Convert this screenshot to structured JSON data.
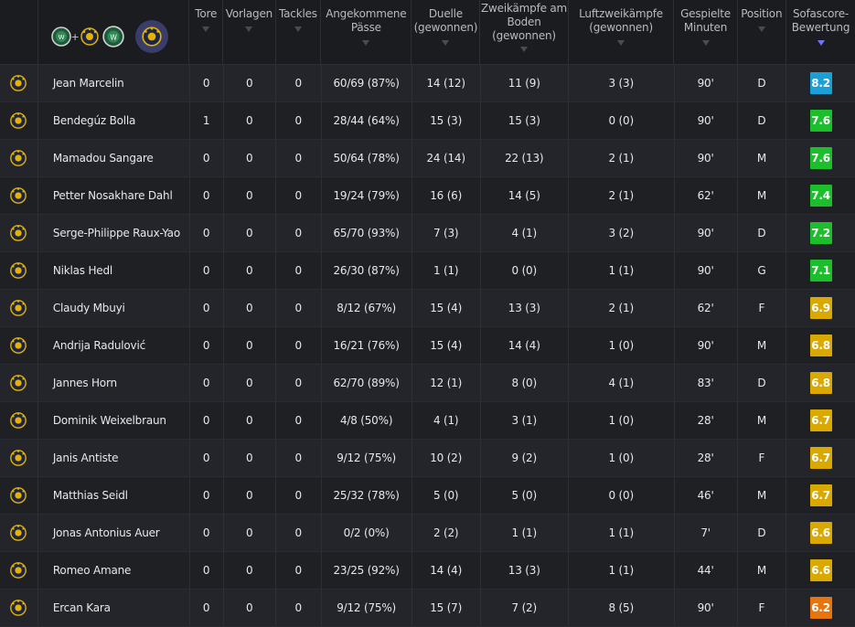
{
  "columns": [
    {
      "label": "Tore"
    },
    {
      "label": "Vorlagen"
    },
    {
      "label": "Tackles"
    },
    {
      "label": "Angekommene Pässe"
    },
    {
      "label": "Duelle (gewonnen)"
    },
    {
      "label": "Zweikämpfe am Boden (gewonnen)"
    },
    {
      "label": "Luftzweikämpfe (gewonnen)"
    },
    {
      "label": "Gespielte Minuten"
    },
    {
      "label": "Position"
    },
    {
      "label": "Sofascore-Bewertung"
    }
  ],
  "team_filter": {
    "plus": "+",
    "icons": [
      "team-a-crest-icon",
      "team-b-crest-icon",
      "team-a-crest-icon",
      "team-b-crest-icon"
    ]
  },
  "colors": {
    "rating_blue": "#1a9fd6",
    "rating_green": "#1cbf2b",
    "rating_yellow": "#d9a900",
    "rating_orange": "#e8740c",
    "sort_active": "#6f73ff"
  },
  "players": [
    {
      "name": "Jean Marcelin",
      "goals": "0",
      "assists": "0",
      "tackles": "0",
      "passes": "60/69 (87%)",
      "duels": "14 (12)",
      "ground": "11 (9)",
      "aerial": "3 (3)",
      "minutes": "90'",
      "position": "D",
      "rating": "8.2",
      "rating_color": "blue"
    },
    {
      "name": "Bendegúz Bolla",
      "goals": "1",
      "assists": "0",
      "tackles": "0",
      "passes": "28/44 (64%)",
      "duels": "15 (3)",
      "ground": "15 (3)",
      "aerial": "0 (0)",
      "minutes": "90'",
      "position": "D",
      "rating": "7.6",
      "rating_color": "green"
    },
    {
      "name": "Mamadou Sangare",
      "goals": "0",
      "assists": "0",
      "tackles": "0",
      "passes": "50/64 (78%)",
      "duels": "24 (14)",
      "ground": "22 (13)",
      "aerial": "2 (1)",
      "minutes": "90'",
      "position": "M",
      "rating": "7.6",
      "rating_color": "green"
    },
    {
      "name": "Petter Nosakhare Dahl",
      "goals": "0",
      "assists": "0",
      "tackles": "0",
      "passes": "19/24 (79%)",
      "duels": "16 (6)",
      "ground": "14 (5)",
      "aerial": "2 (1)",
      "minutes": "62'",
      "position": "M",
      "rating": "7.4",
      "rating_color": "green"
    },
    {
      "name": "Serge-Philippe Raux-Yao",
      "goals": "0",
      "assists": "0",
      "tackles": "0",
      "passes": "65/70 (93%)",
      "duels": "7 (3)",
      "ground": "4 (1)",
      "aerial": "3 (2)",
      "minutes": "90'",
      "position": "D",
      "rating": "7.2",
      "rating_color": "green"
    },
    {
      "name": "Niklas Hedl",
      "goals": "0",
      "assists": "0",
      "tackles": "0",
      "passes": "26/30 (87%)",
      "duels": "1 (1)",
      "ground": "0 (0)",
      "aerial": "1 (1)",
      "minutes": "90'",
      "position": "G",
      "rating": "7.1",
      "rating_color": "green"
    },
    {
      "name": "Claudy Mbuyi",
      "goals": "0",
      "assists": "0",
      "tackles": "0",
      "passes": "8/12 (67%)",
      "duels": "15 (4)",
      "ground": "13 (3)",
      "aerial": "2 (1)",
      "minutes": "62'",
      "position": "F",
      "rating": "6.9",
      "rating_color": "yellow"
    },
    {
      "name": "Andrija Radulović",
      "goals": "0",
      "assists": "0",
      "tackles": "0",
      "passes": "16/21 (76%)",
      "duels": "15 (4)",
      "ground": "14 (4)",
      "aerial": "1 (0)",
      "minutes": "90'",
      "position": "M",
      "rating": "6.8",
      "rating_color": "yellow"
    },
    {
      "name": "Jannes Horn",
      "goals": "0",
      "assists": "0",
      "tackles": "0",
      "passes": "62/70 (89%)",
      "duels": "12 (1)",
      "ground": "8 (0)",
      "aerial": "4 (1)",
      "minutes": "83'",
      "position": "D",
      "rating": "6.8",
      "rating_color": "yellow"
    },
    {
      "name": "Dominik Weixelbraun",
      "goals": "0",
      "assists": "0",
      "tackles": "0",
      "passes": "4/8 (50%)",
      "duels": "4 (1)",
      "ground": "3 (1)",
      "aerial": "1 (0)",
      "minutes": "28'",
      "position": "M",
      "rating": "6.7",
      "rating_color": "yellow"
    },
    {
      "name": "Janis Antiste",
      "goals": "0",
      "assists": "0",
      "tackles": "0",
      "passes": "9/12 (75%)",
      "duels": "10 (2)",
      "ground": "9 (2)",
      "aerial": "1 (0)",
      "minutes": "28'",
      "position": "F",
      "rating": "6.7",
      "rating_color": "yellow"
    },
    {
      "name": "Matthias Seidl",
      "goals": "0",
      "assists": "0",
      "tackles": "0",
      "passes": "25/32 (78%)",
      "duels": "5 (0)",
      "ground": "5 (0)",
      "aerial": "0 (0)",
      "minutes": "46'",
      "position": "M",
      "rating": "6.7",
      "rating_color": "yellow"
    },
    {
      "name": "Jonas Antonius Auer",
      "goals": "0",
      "assists": "0",
      "tackles": "0",
      "passes": "0/2 (0%)",
      "duels": "2 (2)",
      "ground": "1 (1)",
      "aerial": "1 (1)",
      "minutes": "7'",
      "position": "D",
      "rating": "6.6",
      "rating_color": "yellow"
    },
    {
      "name": "Romeo Amane",
      "goals": "0",
      "assists": "0",
      "tackles": "0",
      "passes": "23/25 (92%)",
      "duels": "14 (4)",
      "ground": "13 (3)",
      "aerial": "1 (1)",
      "minutes": "44'",
      "position": "M",
      "rating": "6.6",
      "rating_color": "yellow"
    },
    {
      "name": "Ercan Kara",
      "goals": "0",
      "assists": "0",
      "tackles": "0",
      "passes": "9/12 (75%)",
      "duels": "15 (7)",
      "ground": "7 (2)",
      "aerial": "8 (5)",
      "minutes": "90'",
      "position": "F",
      "rating": "6.2",
      "rating_color": "orange"
    }
  ]
}
